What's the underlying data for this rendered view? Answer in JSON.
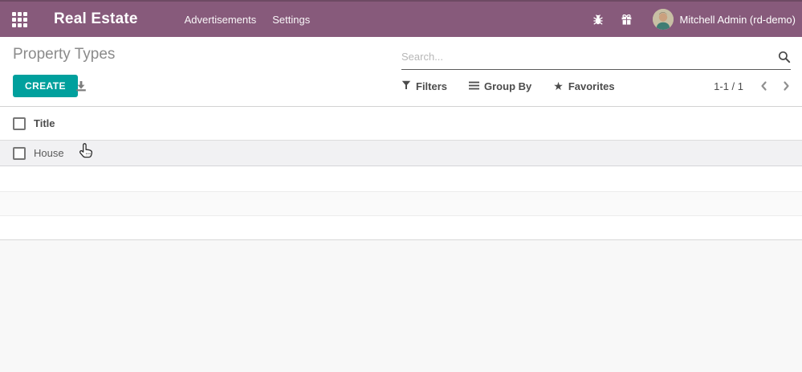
{
  "navbar": {
    "brand": "Real Estate",
    "menus": [
      {
        "label": "Advertisements"
      },
      {
        "label": "Settings"
      }
    ],
    "user_name": "Mitchell Admin (rd-demo)"
  },
  "control_panel": {
    "breadcrumb": "Property Types",
    "search_placeholder": "Search...",
    "create_label": "CREATE",
    "filters_label": "Filters",
    "group_by_label": "Group By",
    "favorites_label": "Favorites",
    "pager_text": "1-1 / 1"
  },
  "list": {
    "column_title": "Title",
    "header_checkbox_checked": false,
    "rows": [
      {
        "title": "House",
        "checked": false
      }
    ]
  },
  "icons": {
    "apps_menu": "grid-icon",
    "debug": "bug-icon",
    "promotion": "gift-icon",
    "search": "magnifier-icon",
    "export": "download-icon",
    "filters": "funnel-icon",
    "group_by": "list-lines-icon",
    "favorites": {
      "name": "star-icon",
      "glyph": "★"
    },
    "pager_previous": "chevron-left-icon",
    "pager_next": "chevron-right-icon",
    "pointer": "hand-cursor"
  },
  "colors": {
    "navbar_bg": "#875A7B",
    "navbar_top_border": "#6d4a63",
    "primary_button": "#00A09D",
    "row_hover": "#f1f1f3",
    "page_background": "#f8f8f8",
    "breadcrumb_text": "#8b8b8b",
    "body_text": "#4c4c4c"
  }
}
